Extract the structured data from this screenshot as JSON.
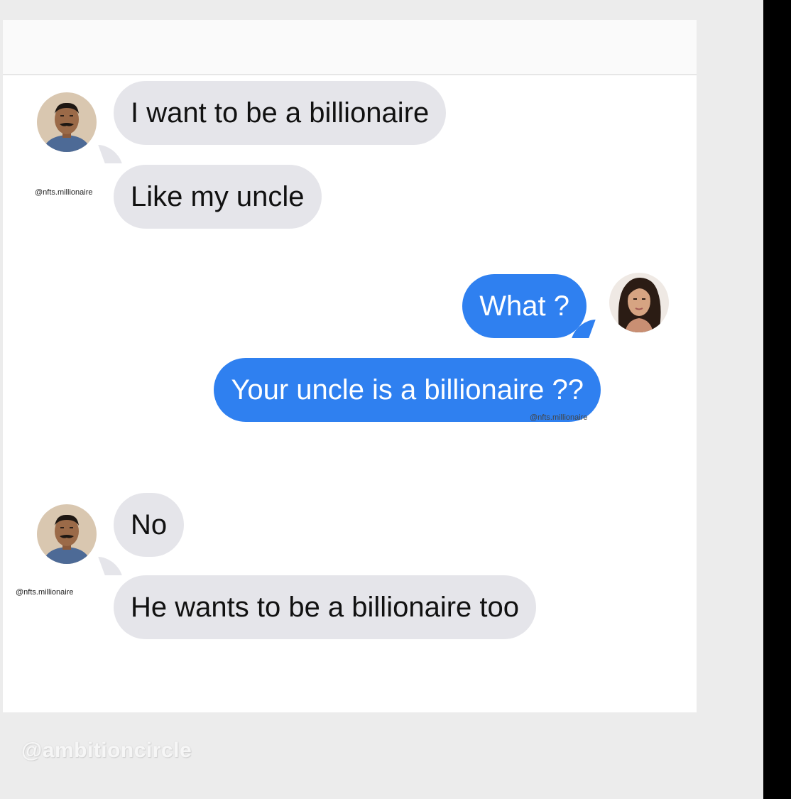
{
  "conversation": {
    "messages": [
      {
        "sender": "uncle",
        "text": "I want to be a billionaire"
      },
      {
        "sender": "uncle",
        "text": "Like my uncle"
      },
      {
        "sender": "woman",
        "text": "What ?"
      },
      {
        "sender": "woman",
        "text": "Your uncle is a billionaire ??"
      },
      {
        "sender": "uncle",
        "text": "No"
      },
      {
        "sender": "uncle",
        "text": "He wants to be a billionaire too"
      }
    ],
    "handles": [
      "@nfts.millionaire",
      "@nfts.millionaire",
      "@nfts.millionaire"
    ]
  },
  "watermark": "@ambitioncircle",
  "colors": {
    "incoming_bubble": "#e5e5ea",
    "outgoing_bubble": "#2f80f0",
    "background": "#ffffff"
  },
  "icons": [
    "man-avatar",
    "woman-avatar"
  ]
}
